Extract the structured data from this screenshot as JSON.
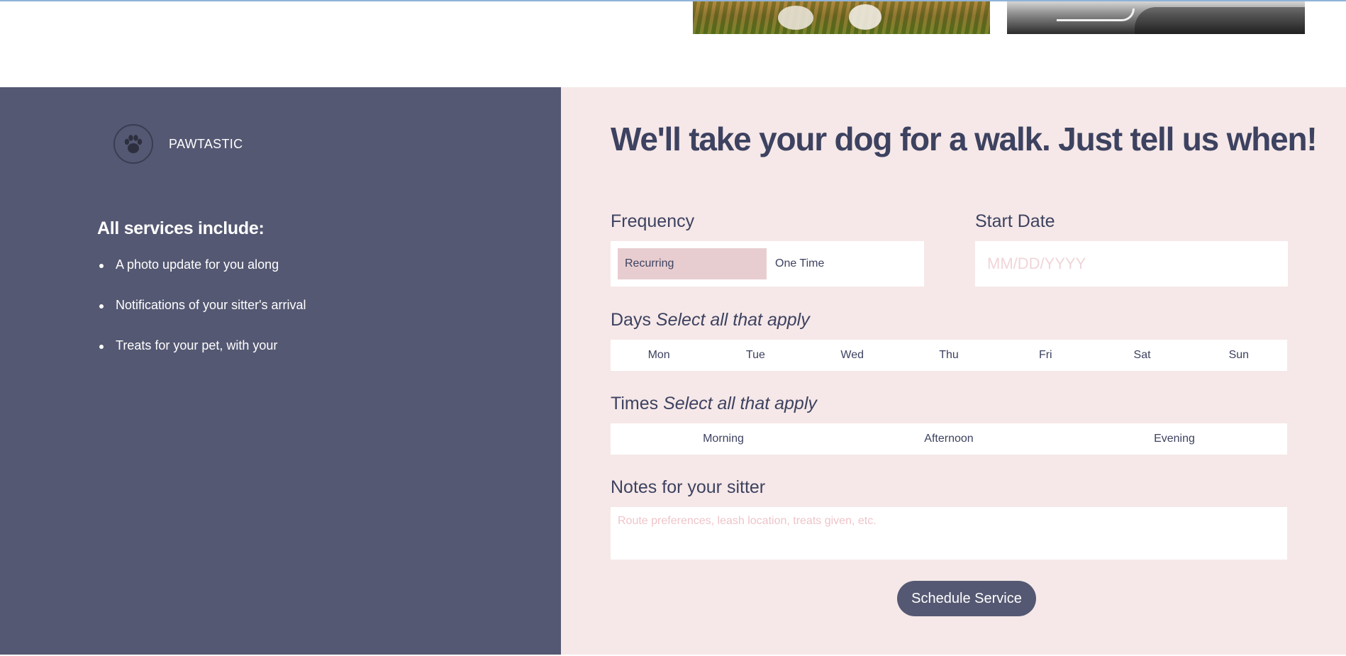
{
  "brand": {
    "name": "PAWTASTIC",
    "logo_icon": "paw-print-icon"
  },
  "services": {
    "title": "All services include:",
    "items": [
      "A photo update for you along",
      "Notifications of your sitter's arrival",
      "Treats for your pet, with your"
    ]
  },
  "form": {
    "headline": "We'll take your dog for a walk. Just tell us when!",
    "frequency": {
      "label": "Frequency",
      "options": [
        "Recurring",
        "One Time"
      ],
      "selected": "Recurring"
    },
    "start_date": {
      "label": "Start Date",
      "placeholder": "MM/DD/YYYY",
      "value": ""
    },
    "days": {
      "label": "Days",
      "hint": "Select all that apply",
      "options": [
        "Mon",
        "Tue",
        "Wed",
        "Thu",
        "Fri",
        "Sat",
        "Sun"
      ]
    },
    "times": {
      "label": "Times",
      "hint": "Select all that apply",
      "options": [
        "Morning",
        "Afternoon",
        "Evening"
      ]
    },
    "notes": {
      "label": "Notes for your sitter",
      "placeholder": "Route preferences, leash location, treats given, etc.",
      "value": ""
    },
    "submit_label": "Schedule Service"
  },
  "colors": {
    "left_panel": "#545872",
    "right_panel": "#f6e8e8",
    "heading_text": "#3d4260",
    "selected_option": "#e8cdd0",
    "button": "#545872"
  }
}
